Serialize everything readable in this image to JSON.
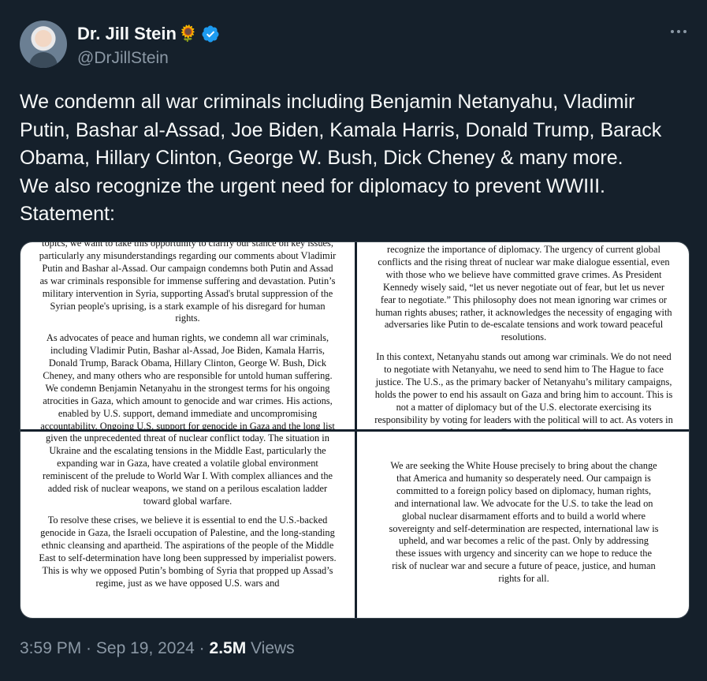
{
  "author": {
    "display_name": "Dr. Jill Stein",
    "emoji": "🌻",
    "handle": "@DrJillStein",
    "verified_color": "#1d9bf0"
  },
  "tweet": {
    "lines": [
      "We condemn all war criminals including Benjamin Netanyahu, Vladimir Putin, Bashar al-Assad, Joe Biden, Kamala Harris, Donald Trump, Barack Obama, Hillary Clinton, George W. Bush, Dick Cheney & many more.",
      "We also recognize the urgent need for diplomacy to prevent WWIII.",
      "Statement:"
    ]
  },
  "statement": {
    "panel1": [
      "topics, we want to take this opportunity to clarify our stance on key issues, particularly any misunderstandings regarding our comments about Vladimir Putin and Bashar al-Assad. Our campaign condemns both Putin and Assad as war criminals responsible for immense suffering and devastation. Putin’s military intervention in Syria, supporting Assad's brutal suppression of the Syrian people's uprising, is a stark example of his disregard for human rights.",
      "As advocates of peace and human rights, we condemn all war criminals, including Vladimir Putin, Bashar al-Assad, Joe Biden, Kamala Harris, Donald Trump, Barack Obama, Hillary Clinton, George W. Bush, Dick Cheney, and many others who are responsible for untold human suffering. We condemn Benjamin Netanyahu in the strongest terms for his ongoing atrocities in Gaza, which amount to genocide and war crimes. His actions, enabled by U.S. support, demand immediate and uncompromising accountability. Ongoing U.S. support for genocide in Gaza and the long list of U.S. wars since"
    ],
    "panel2": [
      "recognize the importance of diplomacy. The urgency of current global conflicts and the rising threat of nuclear war make dialogue essential, even with those who we believe have committed grave crimes. As President Kennedy wisely said, “let us never negotiate out of fear, but let us never fear to negotiate.” This philosophy does not mean ignoring war crimes or human rights abuses; rather, it acknowledges the necessity of engaging with adversaries like Putin to de-escalate tensions and work toward peaceful resolutions.",
      "In this context, Netanyahu stands out among war criminals. We do not need to negotiate with Netanyahu, we need to send him to The Hague to face justice. The U.S., as the primary backer of Netanyahu’s military campaigns, holds the power to end his assault on Gaza and bring him to account. This is not a matter of diplomacy but of the U.S. electorate exercising its responsibility by voting for leaders with the political will to act. As voters in the most powerful nation on Earth, we have an obligation to hold our government"
    ],
    "panel3": [
      "given the unprecedented threat of nuclear conflict today. The situation in Ukraine and the escalating tensions in the Middle East, particularly the expanding war in Gaza, have created a volatile global environment reminiscent of the prelude to World War I. With complex alliances and the added risk of nuclear weapons, we stand on a perilous escalation ladder toward global warfare.",
      "To resolve these crises, we believe it is essential to end the U.S.-backed genocide in Gaza, the Israeli occupation of Palestine, and the long-standing ethnic cleansing and apartheid. The aspirations of the people of the Middle East to self-determination have long been suppressed by imperialist powers. This is why we opposed Putin’s bombing of Syria that propped up Assad’s regime, just as we have opposed U.S. wars and"
    ],
    "panel4": [
      "We are seeking the White House precisely to bring about the change that America and humanity so desperately need. Our campaign is committed to a foreign policy based on diplomacy, human rights, and international law. We advocate for the U.S. to take the lead on global nuclear disarmament efforts and to build a world where sovereignty and self-determination are respected, international law is upheld, and war becomes a relic of the past. Only by addressing these issues with urgency and sincerity can we hope to reduce the risk of nuclear war and secure a future of peace, justice, and human rights for all."
    ]
  },
  "meta": {
    "time": "3:59 PM",
    "separator": " · ",
    "date": "Sep 19, 2024",
    "views_count": "2.5M",
    "views_label": " Views"
  }
}
